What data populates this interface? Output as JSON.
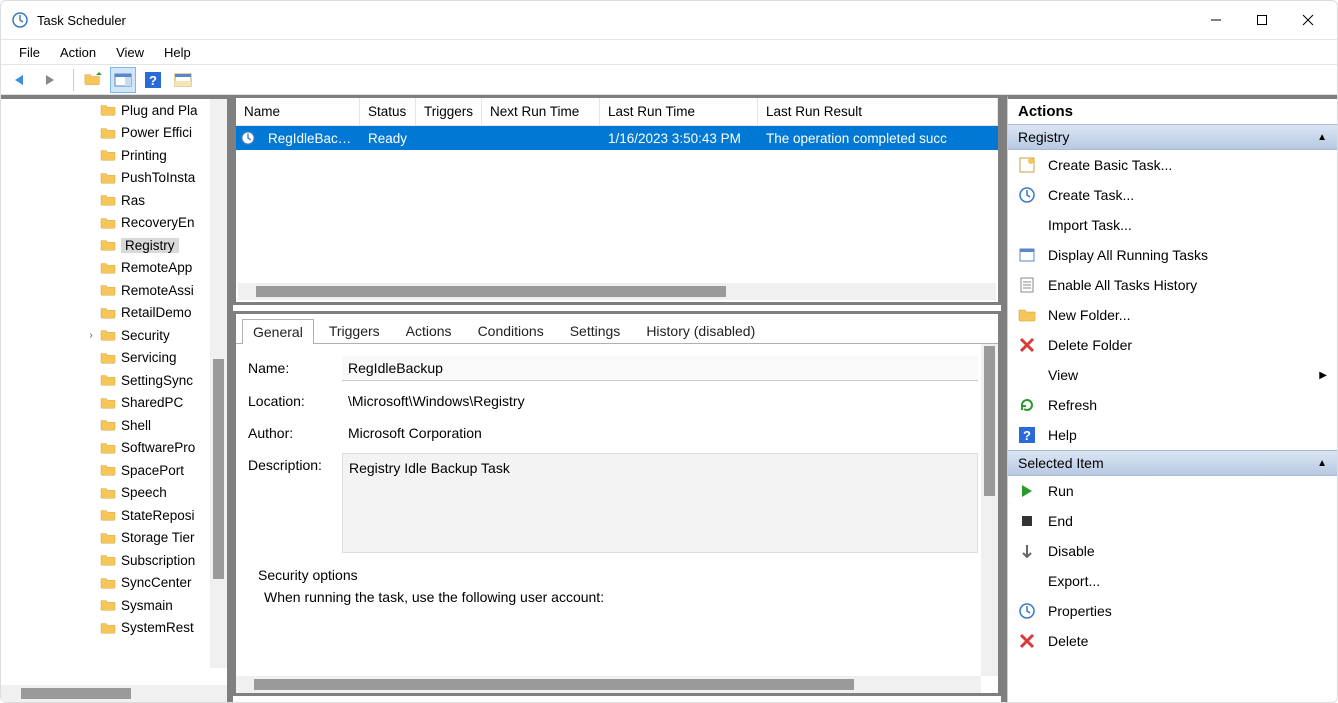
{
  "window": {
    "title": "Task Scheduler"
  },
  "menu": {
    "file": "File",
    "action": "Action",
    "view": "View",
    "help": "Help"
  },
  "tree": {
    "items": [
      {
        "label": "Plug and Pla"
      },
      {
        "label": "Power Effici"
      },
      {
        "label": "Printing"
      },
      {
        "label": "PushToInsta"
      },
      {
        "label": "Ras"
      },
      {
        "label": "RecoveryEn"
      },
      {
        "label": "Registry",
        "selected": true
      },
      {
        "label": "RemoteApp"
      },
      {
        "label": "RemoteAssi"
      },
      {
        "label": "RetailDemo"
      },
      {
        "label": "Security",
        "expandable": true
      },
      {
        "label": "Servicing"
      },
      {
        "label": "SettingSync"
      },
      {
        "label": "SharedPC"
      },
      {
        "label": "Shell"
      },
      {
        "label": "SoftwarePro"
      },
      {
        "label": "SpacePort"
      },
      {
        "label": "Speech"
      },
      {
        "label": "StateReposi"
      },
      {
        "label": "Storage Tier"
      },
      {
        "label": "Subscription"
      },
      {
        "label": "SyncCenter"
      },
      {
        "label": "Sysmain"
      },
      {
        "label": "SystemRest"
      }
    ]
  },
  "list": {
    "columns": {
      "name": "Name",
      "status": "Status",
      "triggers": "Triggers",
      "next": "Next Run Time",
      "last": "Last Run Time",
      "result": "Last Run Result"
    },
    "row": {
      "name": "RegIdleBack...",
      "status": "Ready",
      "triggers": "",
      "next": "",
      "last": "1/16/2023 3:50:43 PM",
      "result": "The operation completed succ"
    }
  },
  "tabs": {
    "general": "General",
    "triggers": "Triggers",
    "actions": "Actions",
    "conditions": "Conditions",
    "settings": "Settings",
    "history": "History (disabled)"
  },
  "general": {
    "name_label": "Name:",
    "name_value": "RegIdleBackup",
    "location_label": "Location:",
    "location_value": "\\Microsoft\\Windows\\Registry",
    "author_label": "Author:",
    "author_value": "Microsoft Corporation",
    "desc_label": "Description:",
    "desc_value": "Registry Idle Backup Task",
    "sec_label": "Security options",
    "sec_sub": "When running the task, use the following user account:"
  },
  "actions": {
    "title": "Actions",
    "section1": "Registry",
    "items1": [
      {
        "label": "Create Basic Task...",
        "icon": "wizard"
      },
      {
        "label": "Create Task...",
        "icon": "task"
      },
      {
        "label": "Import Task...",
        "icon": "none"
      },
      {
        "label": "Display All Running Tasks",
        "icon": "window"
      },
      {
        "label": "Enable All Tasks History",
        "icon": "log"
      },
      {
        "label": "New Folder...",
        "icon": "folder"
      },
      {
        "label": "Delete Folder",
        "icon": "delete"
      },
      {
        "label": "View",
        "icon": "none",
        "submenu": true
      },
      {
        "label": "Refresh",
        "icon": "refresh"
      },
      {
        "label": "Help",
        "icon": "help"
      }
    ],
    "section2": "Selected Item",
    "items2": [
      {
        "label": "Run",
        "icon": "run"
      },
      {
        "label": "End",
        "icon": "end"
      },
      {
        "label": "Disable",
        "icon": "disable"
      },
      {
        "label": "Export...",
        "icon": "none"
      },
      {
        "label": "Properties",
        "icon": "props"
      },
      {
        "label": "Delete",
        "icon": "delete"
      }
    ]
  }
}
